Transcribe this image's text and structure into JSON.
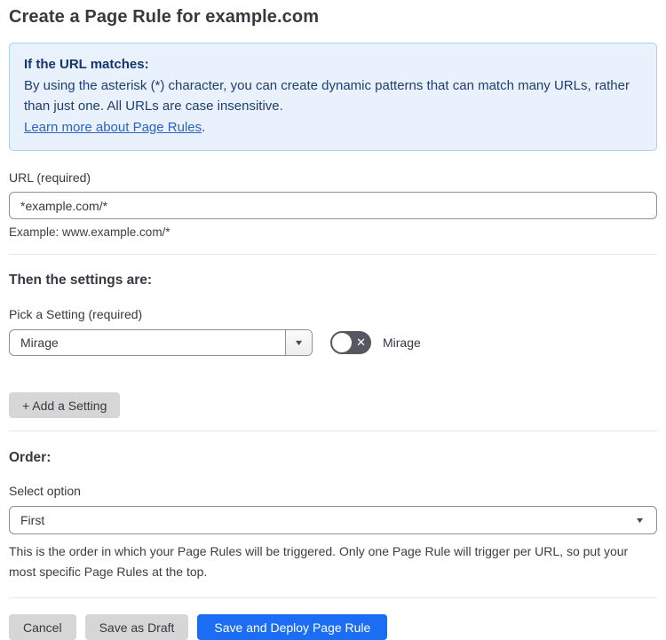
{
  "page": {
    "title": "Create a Page Rule for example.com"
  },
  "info_box": {
    "heading": "If the URL matches:",
    "body": "By using the asterisk (*) character, you can create dynamic patterns that can match many URLs, rather than just one. All URLs are case insensitive.",
    "link_label": "Learn more about Page Rules",
    "link_suffix": "."
  },
  "url_field": {
    "label": "URL (required)",
    "value": "*example.com/*",
    "helper": "Example: www.example.com/*"
  },
  "settings": {
    "heading": "Then the settings are:",
    "picker_label": "Pick a Setting (required)",
    "selected_setting": "Mirage",
    "toggle_label": "Mirage",
    "toggle_state": "off",
    "add_button_label": "+ Add a Setting"
  },
  "order": {
    "heading": "Order:",
    "select_label": "Select option",
    "selected_option": "First",
    "helper": "This is the order in which your Page Rules will be triggered. Only one Page Rule will trigger per URL, so put your most specific Page Rules at the top."
  },
  "footer": {
    "cancel_label": "Cancel",
    "save_draft_label": "Save as Draft",
    "save_deploy_label": "Save and Deploy Page Rule"
  },
  "icons": {
    "dropdown_arrow": "▼",
    "toggle_off_x": "✕"
  },
  "colors": {
    "primary_button": "#1b6ef3",
    "info_box_bg": "#e9f1fc",
    "info_box_border": "#aecdf0",
    "info_text": "#1f3d70",
    "link": "#2d63c4",
    "toggle_off_bg": "#55585e",
    "gray_button_bg": "#d6d6d6",
    "text": "#36393f"
  }
}
